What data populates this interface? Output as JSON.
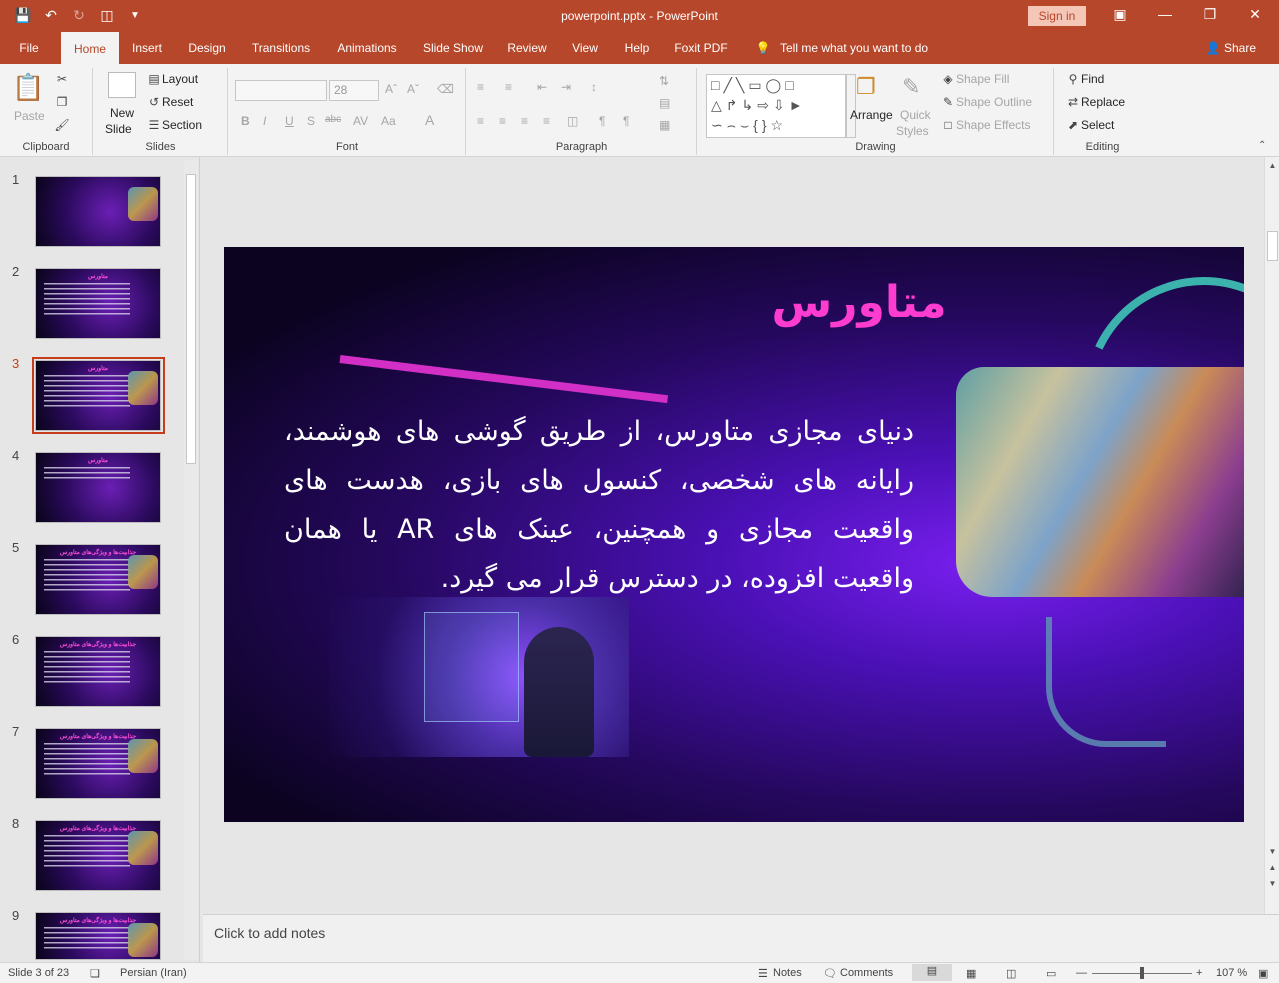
{
  "window": {
    "title": "powerpoint.pptx - PowerPoint",
    "sign_in": "Sign in"
  },
  "qat": {
    "save_icon": "save-icon",
    "undo_icon": "undo-icon",
    "redo_icon": "redo-icon",
    "present_icon": "present-icon",
    "customize_icon": "chevron-down-icon"
  },
  "tabs": [
    "File",
    "Home",
    "Insert",
    "Design",
    "Transitions",
    "Animations",
    "Slide Show",
    "Review",
    "View",
    "Help",
    "Foxit PDF"
  ],
  "tell_me": "Tell me what you want to do",
  "share": "Share",
  "ribbon": {
    "clipboard": {
      "label": "Clipboard",
      "paste": "Paste"
    },
    "slides": {
      "label": "Slides",
      "new_slide_1": "New",
      "new_slide_2": "Slide",
      "layout": "Layout",
      "reset": "Reset",
      "section": "Section"
    },
    "font": {
      "label": "Font",
      "size": "28"
    },
    "paragraph": {
      "label": "Paragraph"
    },
    "drawing": {
      "label": "Drawing",
      "arrange": "Arrange",
      "quick_styles_1": "Quick",
      "quick_styles_2": "Styles",
      "shape_fill": "Shape Fill",
      "shape_outline": "Shape Outline",
      "shape_effects": "Shape Effects"
    },
    "editing": {
      "label": "Editing",
      "find": "Find",
      "replace": "Replace",
      "select": "Select"
    }
  },
  "thumbnails": [
    {
      "num": "1",
      "title": ""
    },
    {
      "num": "2",
      "title": "متاورس"
    },
    {
      "num": "3",
      "title": "متاورس"
    },
    {
      "num": "4",
      "title": "متاورس"
    },
    {
      "num": "5",
      "title": "جذابیت‌ها و ویژگی‌های متاورس"
    },
    {
      "num": "6",
      "title": "جذابیت‌ها و ویژگی‌های متاورس"
    },
    {
      "num": "7",
      "title": "جذابیت‌ها و ویژگی‌های متاورس"
    },
    {
      "num": "8",
      "title": "جذابیت‌ها و ویژگی‌های متاورس"
    },
    {
      "num": "9",
      "title": "جذابیت‌ها و ویژگی‌های متاورس"
    }
  ],
  "slide": {
    "title": "متاورس",
    "body": "دنیای مجازی متاورس، از طریق گوشی های هوشمند، رایانه های شخصی، کنسول های بازی، هدست های واقعیت مجازی و همچنین، عینک های AR یا همان واقعیت افزوده، در دسترس قرار می گیرد."
  },
  "notes_placeholder": "Click to add notes",
  "status": {
    "slide": "Slide 3 of 23",
    "language": "Persian (Iran)",
    "notes": "Notes",
    "comments": "Comments",
    "zoom": "107 %"
  }
}
